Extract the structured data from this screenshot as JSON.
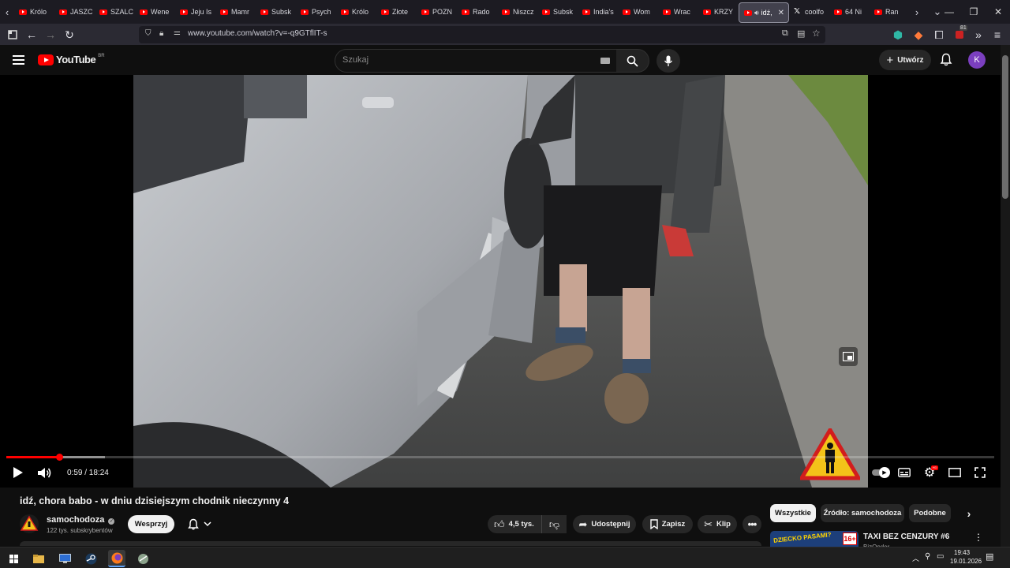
{
  "browser": {
    "tabs": [
      {
        "label": "Królo",
        "favicon": "youtube-icon"
      },
      {
        "label": "JASZC",
        "favicon": "youtube-icon"
      },
      {
        "label": "SZALC",
        "favicon": "youtube-icon"
      },
      {
        "label": "Wene",
        "favicon": "youtube-icon"
      },
      {
        "label": "Jeju Is",
        "favicon": "youtube-icon"
      },
      {
        "label": "Mamr",
        "favicon": "youtube-icon"
      },
      {
        "label": "Subsk",
        "favicon": "youtube-icon"
      },
      {
        "label": "Psych",
        "favicon": "youtube-icon"
      },
      {
        "label": "Królo",
        "favicon": "youtube-icon"
      },
      {
        "label": "Złote",
        "favicon": "youtube-icon"
      },
      {
        "label": "POZN",
        "favicon": "youtube-icon"
      },
      {
        "label": "Rado",
        "favicon": "youtube-icon"
      },
      {
        "label": "Niszcz",
        "favicon": "youtube-icon"
      },
      {
        "label": "Subsk",
        "favicon": "youtube-icon"
      },
      {
        "label": "India's",
        "favicon": "youtube-icon"
      },
      {
        "label": "Wom",
        "favicon": "youtube-icon"
      },
      {
        "label": "Wrac",
        "favicon": "youtube-icon"
      },
      {
        "label": "KRZY",
        "favicon": "youtube-icon"
      }
    ],
    "active_tab": {
      "label": "idź,",
      "favicon": "youtube-icon"
    },
    "tabs_after": [
      {
        "label": "coolfo",
        "favicon": "x-icon"
      },
      {
        "label": "64 Ni",
        "favicon": "youtube-icon"
      },
      {
        "label": "Ran",
        "favicon": "youtube-icon"
      }
    ],
    "url": "www.youtube.com/watch?v=-q9GTflIT-s",
    "extension_badge": "81"
  },
  "youtube": {
    "logo_text": "YouTube",
    "country_code": "BR",
    "search_placeholder": "Szukaj",
    "create_label": "Utwórz",
    "avatar_letter": "K"
  },
  "player": {
    "current_time": "0:59",
    "duration": "18:24",
    "time_display": "0:59 / 18:24",
    "progress_fraction": 0.0534,
    "buffered_fraction": 0.1,
    "watermark_icon": "warning-pedestrian-icon"
  },
  "video": {
    "title": "idź, chora babo - w dniu dzisiejszym chodnik nieczynny 4",
    "channel_name": "samochodoza",
    "subscribers": "122 tys. subskrybentów",
    "support_label": "Wesprzyj",
    "like_count": "4,5 tys.",
    "share_label": "Udostępnij",
    "save_label": "Zapisz",
    "clip_label": "Klip"
  },
  "sidebar": {
    "chips": [
      "Wszystkie",
      "Źródło: samochodoza",
      "Podobne"
    ],
    "active_chip": "Wszystkie",
    "recommendation": {
      "title": "TAXI BEZ CENZURY #6",
      "channel": "BizOnder",
      "thumb_text": "DZIECKO PASAMI?",
      "age_badge": "16+"
    }
  },
  "taskbar": {
    "time": "19:43",
    "date": "19.01.2026"
  },
  "colors": {
    "youtube_red": "#ff0000",
    "bg": "#0f0f0f",
    "chip_active_bg": "#f1f1f1"
  }
}
